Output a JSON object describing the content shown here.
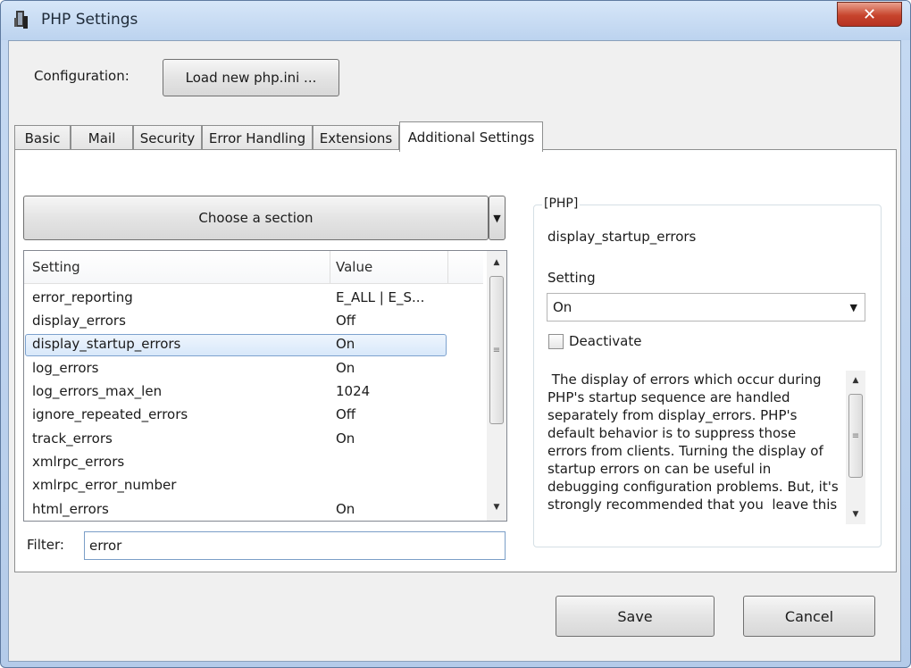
{
  "window": {
    "title": "PHP Settings",
    "close_glyph": "✕",
    "icon": "php-app-icon"
  },
  "config": {
    "label": "Configuration:",
    "load_button": "Load new php.ini ..."
  },
  "tabs": [
    {
      "label": "Basic"
    },
    {
      "label": "Mail"
    },
    {
      "label": "Security"
    },
    {
      "label": "Error Handling"
    },
    {
      "label": "Extensions"
    },
    {
      "label": "Additional Settings",
      "active": true
    }
  ],
  "section": {
    "label": "Choose a section",
    "arrow": "▼"
  },
  "list": {
    "columns": {
      "setting": "Setting",
      "value": "Value"
    },
    "rows": [
      {
        "name": "error_reporting",
        "value": "E_ALL | E_S..."
      },
      {
        "name": "display_errors",
        "value": "Off"
      },
      {
        "name": "display_startup_errors",
        "value": "On",
        "selected": true
      },
      {
        "name": "log_errors",
        "value": "On"
      },
      {
        "name": "log_errors_max_len",
        "value": "1024"
      },
      {
        "name": "ignore_repeated_errors",
        "value": "Off"
      },
      {
        "name": "track_errors",
        "value": "On"
      },
      {
        "name": "xmlrpc_errors",
        "value": ""
      },
      {
        "name": "xmlrpc_error_number",
        "value": ""
      },
      {
        "name": "html_errors",
        "value": "On"
      }
    ]
  },
  "filter": {
    "label": "Filter:",
    "value": "error"
  },
  "details": {
    "group_title": "[PHP]",
    "setting_name": "display_startup_errors",
    "setting_label": "Setting",
    "setting_value": "On",
    "deactivate_label": "Deactivate",
    "deactivate_checked": false,
    "description": " The display of errors which occur during\nPHP's startup sequence are handled\nseparately from display_errors. PHP's\ndefault behavior is to suppress those\nerrors from clients. Turning the display of\nstartup errors on can be useful in\ndebugging configuration problems. But, it's\nstrongly recommended that you  leave this"
  },
  "buttons": {
    "save": "Save",
    "cancel": "Cancel"
  },
  "colors": {
    "titlebar": "#c6daf3",
    "close": "#c7442c",
    "selection": "#d8e8fa"
  }
}
